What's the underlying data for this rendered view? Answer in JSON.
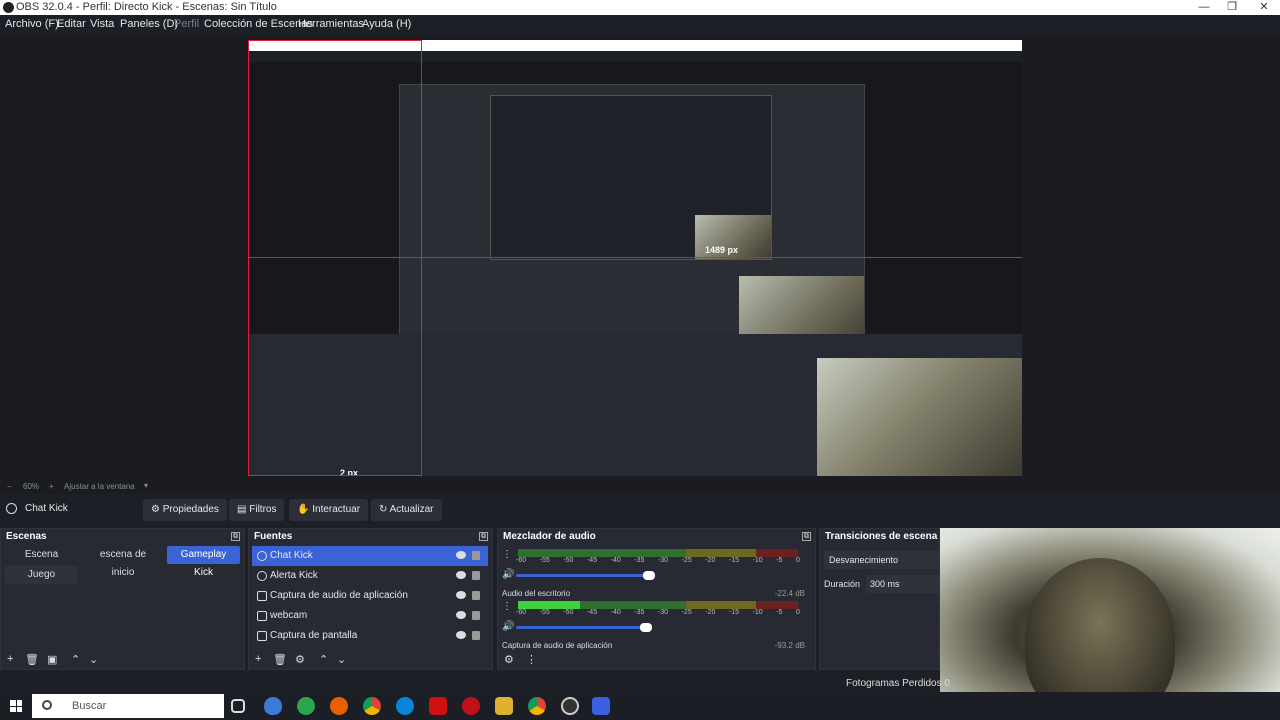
{
  "window": {
    "title": "OBS 32.0.4 - Perfil: Directo Kick - Escenas: Sin Título",
    "minimize": "—",
    "maximize": "❐",
    "close": "✕"
  },
  "menu": [
    {
      "label": "Archivo (F)",
      "dim": false
    },
    {
      "label": "Editar",
      "dim": false
    },
    {
      "label": "Vista",
      "dim": false
    },
    {
      "label": "Paneles (D)",
      "dim": false
    },
    {
      "label": "Perfil",
      "dim": true
    },
    {
      "label": "Colección de Escenas",
      "dim": false
    },
    {
      "label": "Herramientas",
      "dim": false
    },
    {
      "label": "Ayuda (H)",
      "dim": false
    }
  ],
  "preview": {
    "px_label_1": "1489 px",
    "px_label_2": "2 px"
  },
  "zoom": {
    "minus": "−",
    "value": "60%",
    "plus": "+",
    "fit": "Ajustar a la ventana"
  },
  "toolbar": {
    "source_name": "Chat Kick",
    "properties": "Propiedades",
    "filters": "Filtros",
    "interact": "Interactuar",
    "refresh": "Actualizar"
  },
  "scenes": {
    "title": "Escenas",
    "items": [
      "Escena",
      "escena de inicio",
      "Gameplay Kick",
      "Juego"
    ],
    "active": "Gameplay Kick"
  },
  "sources": {
    "title": "Fuentes",
    "items": [
      "Chat Kick",
      "Alerta Kick",
      "Captura de audio de aplicación",
      "webcam",
      "Captura de pantalla"
    ],
    "selected": "Chat Kick"
  },
  "mixer": {
    "title": "Mezclador de audio",
    "ticks": [
      "-60",
      "-55",
      "-50",
      "-45",
      "-40",
      "-35",
      "-30",
      "-25",
      "-20",
      "-15",
      "-10",
      "-5",
      "0"
    ],
    "channels": [
      {
        "name": "",
        "db": "",
        "level": 0.0,
        "volume": 0.95
      },
      {
        "name": "Audio del escritorio",
        "db": "-22.4 dB",
        "level": 0.22,
        "volume": 0.93
      },
      {
        "name": "Captura de audio de aplicación",
        "db": "-93.2 dB",
        "level": 0.0,
        "volume": 0.0
      }
    ]
  },
  "transitions": {
    "title": "Transiciones de escena",
    "selected": "Desvanecimiento",
    "duration_label": "Duración",
    "duration_value": "300 ms"
  },
  "status": {
    "dropped_frames": "Fotogramas Perdidos 0"
  },
  "taskbar": {
    "search_placeholder": "Buscar"
  }
}
